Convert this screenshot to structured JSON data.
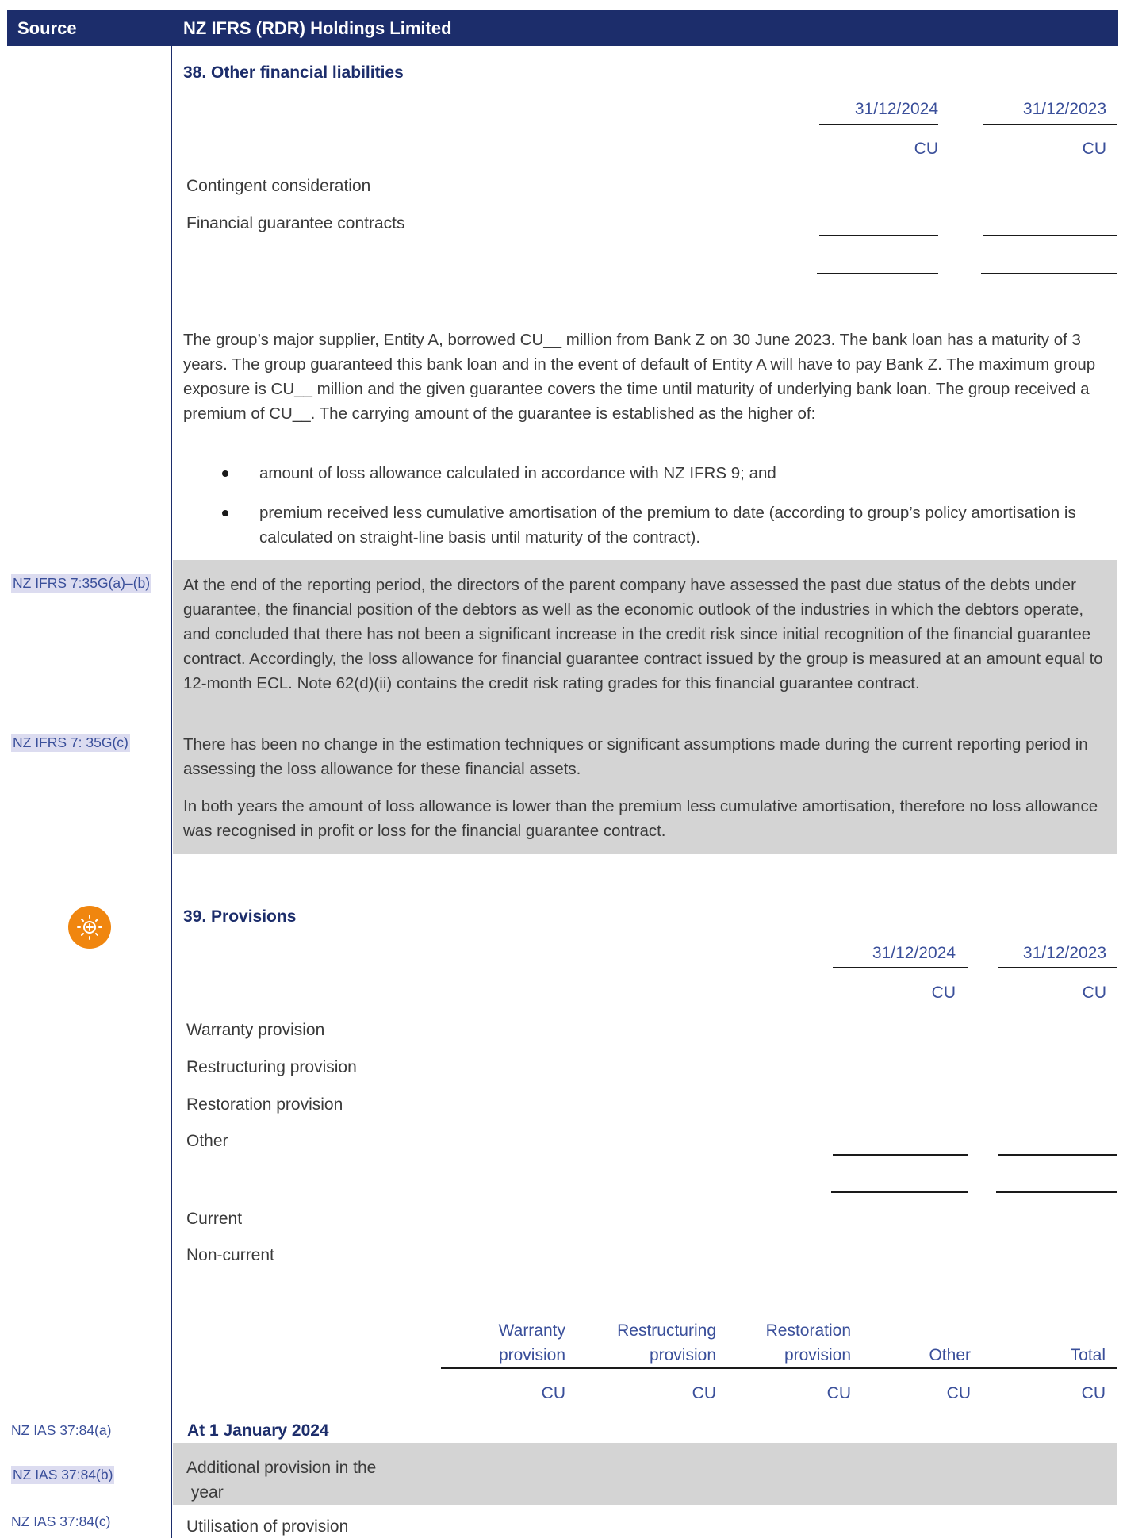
{
  "header": {
    "source_label": "Source",
    "entity_label": "NZ IFRS (RDR) Holdings Limited"
  },
  "note38": {
    "title": "38. Other financial liabilities",
    "columns": [
      "31/12/2024",
      "31/12/2023"
    ],
    "unit": "CU",
    "rows": [
      "Contingent consideration",
      "Financial guarantee contracts"
    ],
    "paragraph": "The group’s major supplier, Entity A, borrowed CU__ million from Bank Z on 30 June 2023. The bank loan has a maturity of 3 years. The group guaranteed this bank loan and in the event of default of Entity A will have to pay Bank Z. The maximum group exposure is CU__ million and the given guarantee covers the time until maturity of underlying bank loan. The group received a premium of CU__. The carrying amount of the guarantee is established as the higher of:",
    "bullets": [
      "amount of loss allowance calculated in accordance with NZ IFRS 9; and",
      "premium received less cumulative amortisation of the premium to date (according to group’s policy amortisation is calculated on straight-line basis until maturity of the contract)."
    ],
    "grey_paragraphs": [
      "At the end of the reporting period, the directors of the parent company have assessed the past due status of the debts under guarantee, the financial position of the debtors as well as the economic outlook of the industries in which the debtors operate, and concluded that there has not been a significant increase in the credit risk since initial recognition of the financial guarantee contract. Accordingly, the loss allowance for financial guarantee contract issued by the group is measured at an amount equal to 12-month ECL. Note 62(d)(ii) contains the credit risk rating grades for this financial guarantee contract.",
      "There has been no change in the estimation techniques or significant assumptions made during the current reporting period in assessing the loss allowance for these financial assets.",
      "In both years the amount of loss allowance is lower than the premium less cumulative amortisation, therefore no loss allowance was recognised in profit or loss for the financial guarantee contract."
    ],
    "refs": [
      "NZ IFRS 7:35G(a)–(b)",
      "NZ IFRS 7: 35G(c)"
    ]
  },
  "note39": {
    "title": "39. Provisions",
    "columns": [
      "31/12/2024",
      "31/12/2023"
    ],
    "unit": "CU",
    "rows": [
      "Warranty provision",
      "Restructuring provision",
      "Restoration provision",
      "Other"
    ],
    "rows2": [
      "Current",
      "Non-current"
    ],
    "movement_headers": [
      [
        "Warranty",
        "provision"
      ],
      [
        "Restructuring",
        "provision"
      ],
      [
        "Restoration",
        "provision"
      ],
      [
        "",
        "Other"
      ],
      [
        "",
        "Total"
      ]
    ],
    "movement_rows": [
      {
        "ref": "NZ IAS 37:84(a)",
        "label": "At 1 January 2024"
      },
      {
        "ref": "NZ IAS 37:84(b)",
        "label_lines": [
          "Additional provision in the",
          " year"
        ]
      },
      {
        "ref": "NZ IAS 37:84(c)",
        "label": "Utilisation of provision"
      }
    ]
  }
}
